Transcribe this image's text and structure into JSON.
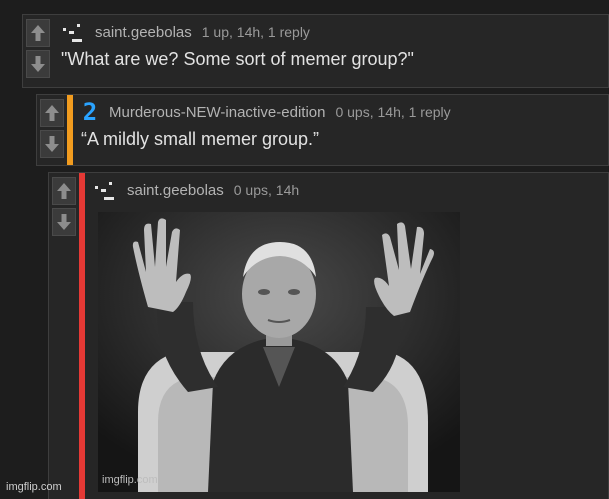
{
  "comments": [
    {
      "username": "saint.geebolas",
      "stats": "1 up, 14h, 1 reply",
      "text": "\"What are we? Some sort of memer group?\"",
      "accent_color": "#262626"
    },
    {
      "username": "Murderous-NEW-inactive-edition",
      "stats": "0 ups, 14h, 1 reply",
      "text": "“A mildly small memer group.”",
      "accent_color": "#f29c1f",
      "avatar_glyph": "2"
    },
    {
      "username": "saint.geebolas",
      "stats": "0 ups, 14h",
      "accent_color": "#e53935",
      "image_watermark": "imgflip.com"
    }
  ],
  "footer": {
    "site_mark": "imgflip.com"
  },
  "icons": {
    "upvote": "up-arrow-icon",
    "downvote": "down-arrow-icon"
  }
}
